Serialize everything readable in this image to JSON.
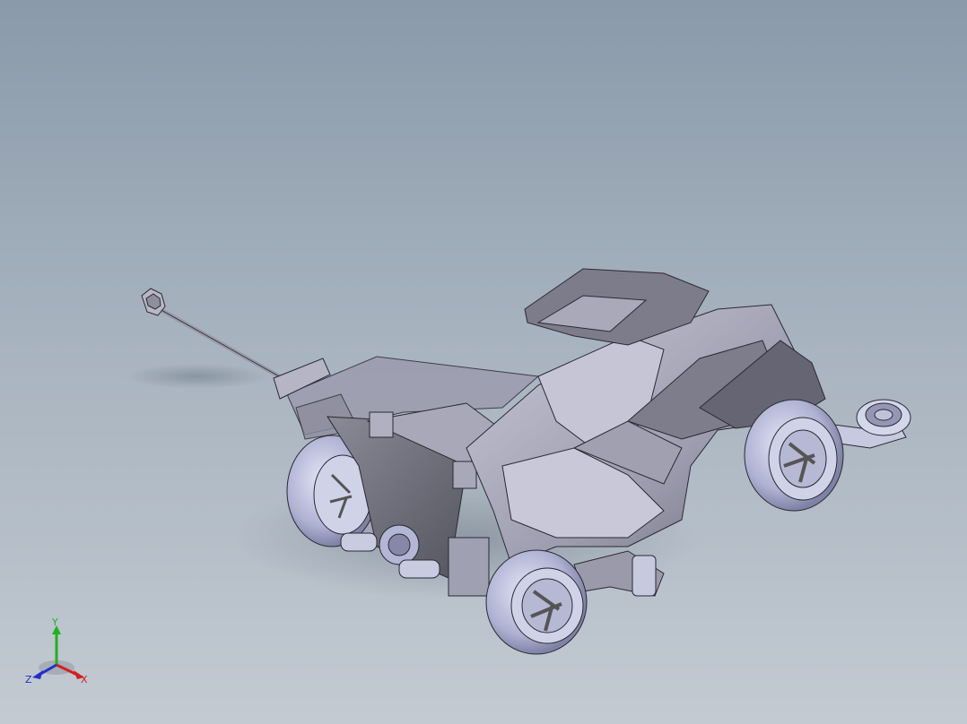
{
  "viewport": {
    "background_top": "#8a9aaa",
    "background_bottom": "#c3cad2"
  },
  "model": {
    "description_icon": "3d-car-model",
    "body_fill": "#9c9ca8",
    "body_dark": "#6f6f7c",
    "body_light": "#c7c7d6",
    "wheel_fill": "#b4b6d6",
    "rim_fill": "#d9dbee",
    "edge_color": "#2a2a33"
  },
  "triad": {
    "x_label": "X",
    "y_label": "Y",
    "z_label": "Z",
    "x_color": "#d21f1f",
    "y_color": "#1fb21f",
    "z_color": "#2430c8"
  }
}
